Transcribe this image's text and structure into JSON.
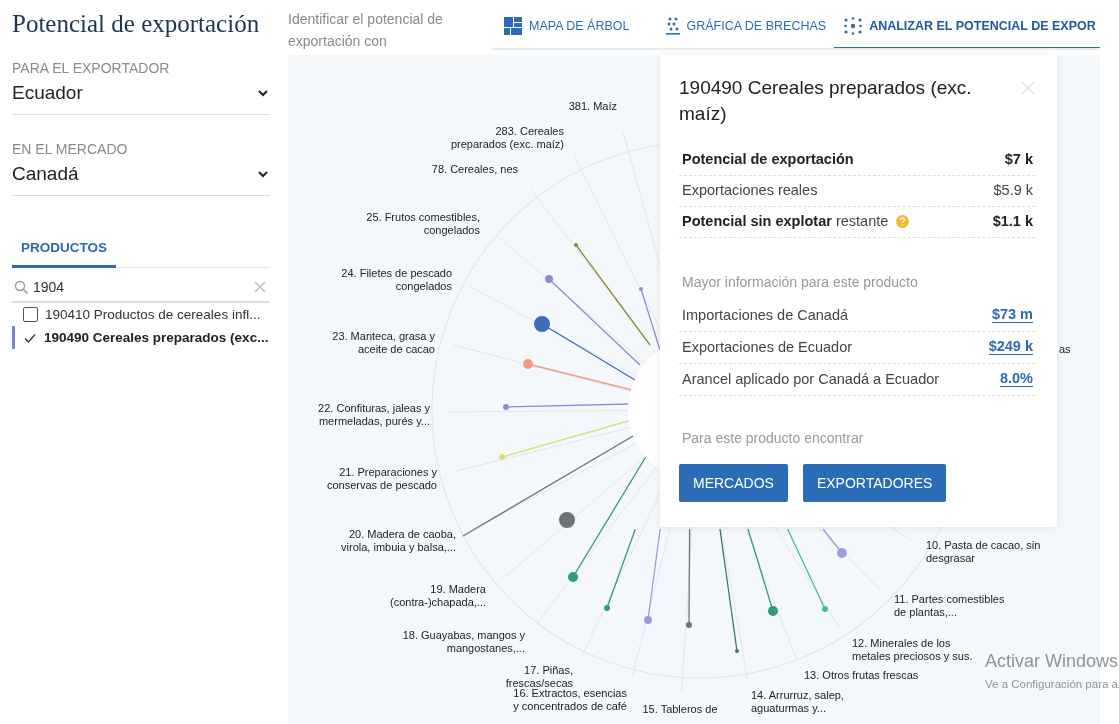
{
  "title": "Potencial de exportación",
  "filters": [
    {
      "label": "PARA EL EXPORTADOR",
      "value": "Ecuador"
    },
    {
      "label": "EN EL MERCADO",
      "value": "Canadá"
    }
  ],
  "products_tab": {
    "label": "PRODUCTOS",
    "selected": true
  },
  "search": {
    "value": "1904"
  },
  "products": [
    {
      "label": "190410 Productos de cereales infl...",
      "checked": false
    },
    {
      "label": "190490 Cereales preparados (exc...",
      "checked": true
    }
  ],
  "intro": "Identificar el potencial de exportación con",
  "tabs": [
    {
      "label": "MAPA DE ÁRBOL",
      "selected": false
    },
    {
      "label": "GRÁFICA DE BRECHAS",
      "selected": false
    },
    {
      "label": "ANALIZAR EL POTENCIAL DE EXPOR",
      "selected": true
    }
  ],
  "chart_labels": [
    {
      "lines": [
        "381. Maíz"
      ]
    },
    {
      "lines": [
        "283. Cereales",
        "preparados (exc. maíz)"
      ]
    },
    {
      "lines": [
        "78. Cereales, nes"
      ]
    },
    {
      "lines": [
        "25. Frutos comestibles,",
        "congelados"
      ]
    },
    {
      "lines": [
        "24. Filetes de pescado",
        "congelados"
      ]
    },
    {
      "lines": [
        "23. Manteca, grasa y",
        "aceite de cacao"
      ]
    },
    {
      "lines": [
        "22. Confituras, jaleas y",
        "mermeladas, purés y..."
      ]
    },
    {
      "lines": [
        "21. Preparaciones y",
        "conservas de pescado"
      ]
    },
    {
      "lines": [
        "20. Madera de caoba,",
        "virola, imbuia y balsa,..."
      ]
    },
    {
      "lines": [
        "19. Madera",
        "(contra-)chapada,..."
      ]
    },
    {
      "lines": [
        "18. Guayabas, mangos y",
        "mangostanes,..."
      ]
    },
    {
      "lines": [
        "17. Piñas,",
        "frescas/secas"
      ]
    },
    {
      "lines": [
        "16. Extractos, esencias",
        "y concentrados de café"
      ]
    },
    {
      "lines": [
        "15. Tableros de"
      ]
    },
    {
      "lines": [
        "14. Arrurruz, salep,",
        "aguaturmas y..."
      ]
    },
    {
      "lines": [
        "13. Otros frutas frescas"
      ]
    },
    {
      "lines": [
        "12. Minerales de los",
        "metales preciosos y sus."
      ]
    },
    {
      "lines": [
        "11. Partes comestibles",
        "de plantas,..."
      ]
    },
    {
      "lines": [
        "10. Pasta de cacao, sin",
        "desgrasar"
      ]
    },
    {
      "lines": [
        "as"
      ]
    }
  ],
  "detail": {
    "title": "190490 Cereales preparados (exc. maíz)",
    "metrics": [
      {
        "label": "Potencial de exportación",
        "value": "$7 k",
        "bold_label": true,
        "bold_value": true,
        "help": false
      },
      {
        "label": "Exportaciones reales",
        "value": "$5.9 k",
        "bold_label": false,
        "bold_value": false,
        "help": false
      },
      {
        "label": "**Potencial sin explotar** restante",
        "value": "$1.1 k",
        "bold_label": false,
        "bold_value": true,
        "help": true
      }
    ],
    "more_heading": "Mayor información para este producto",
    "links": [
      {
        "label": "Importaciones de Canadá",
        "value": "$73 m"
      },
      {
        "label": "Exportaciones de Ecuador",
        "value": "$249 k"
      },
      {
        "label": "Arancel aplicado por Canadá a Ecuador",
        "value": "8.0%"
      }
    ],
    "find_heading": "Para este producto encontrar",
    "buttons": [
      "MERCADOS",
      "EXPORTADORES"
    ]
  },
  "os_notice": {
    "title": "Activar Windows",
    "text": "Ve a Configuración para a"
  }
}
